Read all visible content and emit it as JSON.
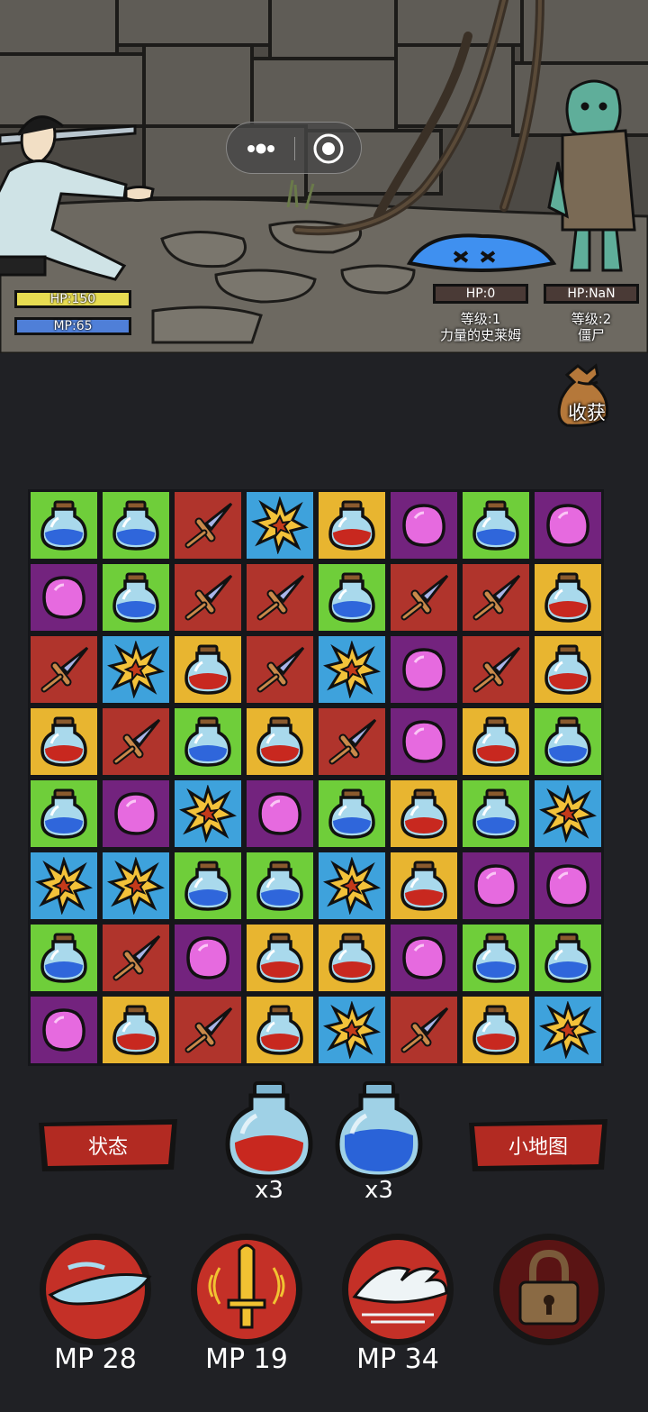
{
  "capsule": {
    "more_icon": "more-dots-icon",
    "close_icon": "target-close-icon"
  },
  "player": {
    "hp_label": "HP:150",
    "mp_label": "MP:65",
    "hp": 150,
    "mp": 65
  },
  "enemies": [
    {
      "hp_label": "HP:0",
      "level": "等级:1",
      "name": "力量的史莱姆"
    },
    {
      "hp_label": "HP:NaN",
      "level": "等级:2",
      "name": "僵尸"
    }
  ],
  "harvest": {
    "label": "收获",
    "icon": "loot-bag-icon"
  },
  "board": {
    "rows": [
      [
        "blue",
        "blue",
        "sword",
        "burst",
        "red",
        "orb",
        "blue",
        "orb"
      ],
      [
        "orb",
        "blue",
        "sword",
        "sword",
        "blue",
        "sword",
        "sword",
        "red"
      ],
      [
        "sword",
        "burst",
        "red",
        "sword",
        "burst",
        "orb",
        "sword",
        "red"
      ],
      [
        "red",
        "sword",
        "blue",
        "red",
        "sword",
        "orb",
        "red",
        "blue"
      ],
      [
        "blue",
        "orb",
        "burst",
        "orb",
        "blue",
        "red",
        "blue",
        "burst"
      ],
      [
        "burst",
        "burst",
        "blue",
        "blue",
        "burst",
        "red",
        "orb",
        "orb"
      ],
      [
        "blue",
        "sword",
        "orb",
        "red",
        "red",
        "orb",
        "blue",
        "blue"
      ],
      [
        "orb",
        "red",
        "sword",
        "red",
        "burst",
        "sword",
        "red",
        "burst"
      ]
    ],
    "tile_colors": {
      "blue": "#6fce3a",
      "red": "#e8b530",
      "sword": "#b0342c",
      "burst": "#3ea2dc",
      "orb": "#73237e"
    }
  },
  "buttons": {
    "status": "状态",
    "minimap": "小地图"
  },
  "potions": [
    {
      "name": "hp-potion",
      "count": "x3",
      "color": "#c8281f"
    },
    {
      "name": "mp-potion",
      "count": "x3",
      "color": "#2a63d8"
    }
  ],
  "skills": [
    {
      "icon": "wind-slash-icon",
      "cost": "MP 28"
    },
    {
      "icon": "holy-sword-icon",
      "cost": "MP 19"
    },
    {
      "icon": "wave-strike-icon",
      "cost": "MP 34"
    },
    {
      "icon": "lock-icon",
      "cost": ""
    }
  ]
}
